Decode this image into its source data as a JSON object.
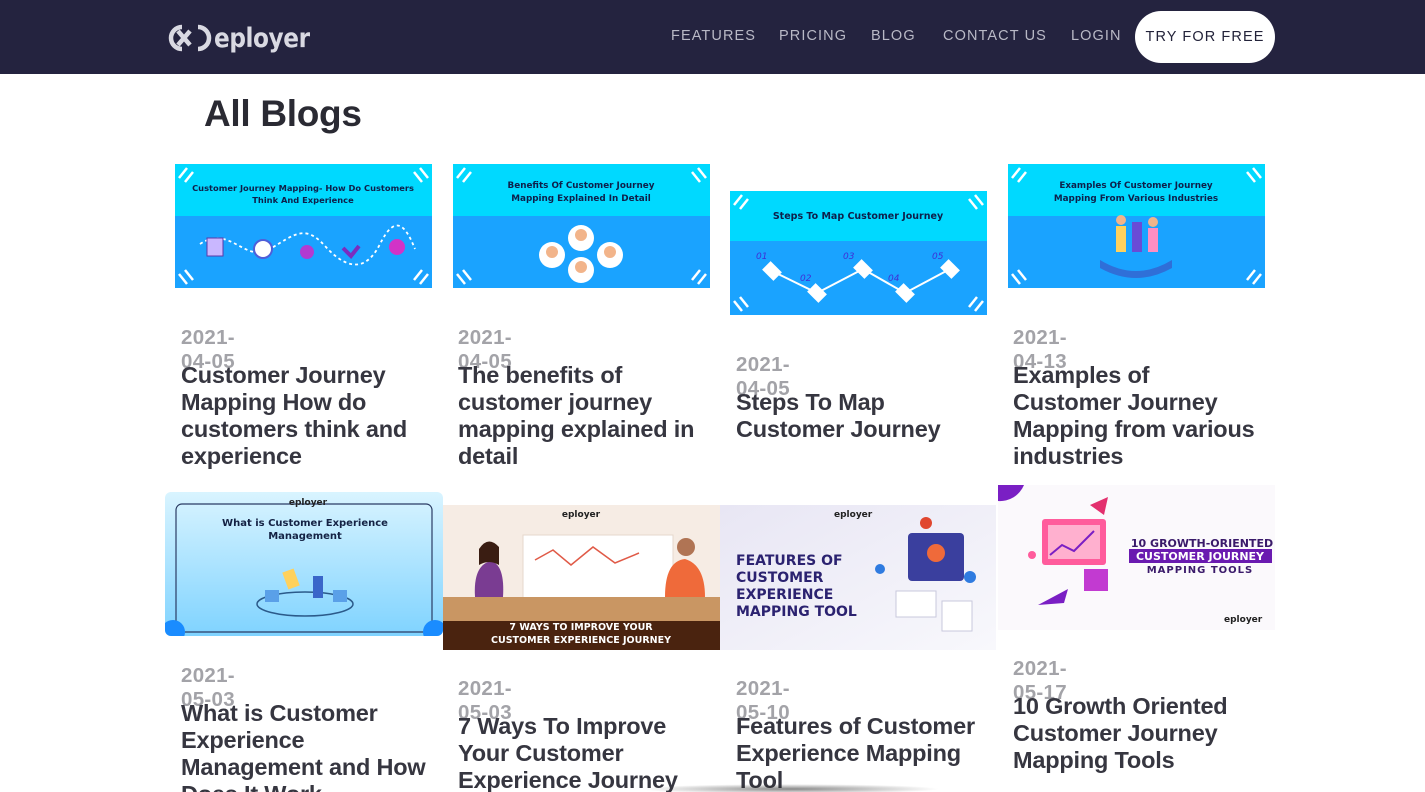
{
  "brand": {
    "name": "eployer"
  },
  "nav": {
    "features": "FEATURES",
    "pricing": "PRICING",
    "blog": "BLOG",
    "contact": "CONTACT US",
    "login": "LOGIN",
    "cta": "TRY FOR FREE"
  },
  "page": {
    "title": "All Blogs"
  },
  "colors": {
    "header_bg": "#24233f",
    "thumb_cyan": "#00d9ff",
    "thumb_blue": "#1aa3ff",
    "text_dark": "#363640",
    "date_gray": "#a3a3a8"
  },
  "posts": [
    {
      "date": "2021-04-05",
      "title": "Customer Journey Mapping How do customers think and experience",
      "image_text": [
        "Customer Journey Mapping- How Do Customers",
        "Think And Experience"
      ]
    },
    {
      "date": "2021-04-05",
      "title": "The benefits of customer journey mapping explained in detail",
      "image_text": [
        "Benefits Of Customer Journey",
        "Mapping Explained In Detail"
      ]
    },
    {
      "date": "2021-04-05",
      "title": "Steps To Map Customer Journey",
      "image_text": [
        "Steps To Map Customer Journey"
      ],
      "image_steps": [
        "01",
        "02",
        "03",
        "04",
        "05"
      ]
    },
    {
      "date": "2021-04-13",
      "title": "Examples of Customer Journey Mapping from various industries",
      "image_text": [
        "Examples Of Customer Journey",
        "Mapping From Various Industries"
      ]
    },
    {
      "date": "2021-05-03",
      "title": "What is Customer Experience Management and How Does It Work",
      "image_text": [
        "What is Customer Experience",
        "Management"
      ],
      "image_brand": "eployer"
    },
    {
      "date": "2021-05-03",
      "title": "7 Ways To Improve Your Customer Experience Journey",
      "image_text": [
        "7 WAYS TO IMPROVE YOUR",
        "CUSTOMER EXPERIENCE JOURNEY"
      ],
      "image_brand": "eployer"
    },
    {
      "date": "2021-05-10",
      "title": "Features of Customer Experience Mapping Tool",
      "image_text": [
        "FEATURES OF",
        "CUSTOMER",
        "EXPERIENCE",
        "MAPPING TOOL"
      ],
      "image_brand": "eployer"
    },
    {
      "date": "2021-05-17",
      "title": "10 Growth Oriented Customer Journey Mapping Tools",
      "image_text": [
        "10 GROWTH-ORIENTED",
        "CUSTOMER JOURNEY",
        "MAPPING TOOLS"
      ],
      "image_brand": "eployer"
    }
  ]
}
